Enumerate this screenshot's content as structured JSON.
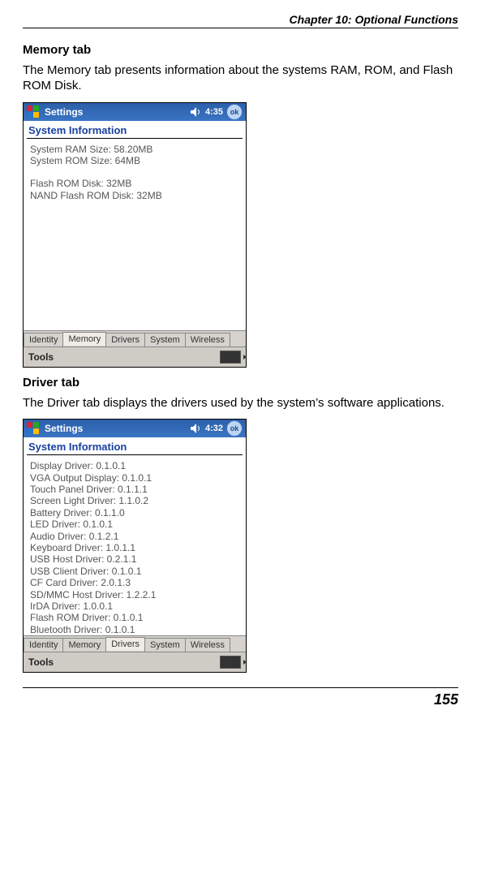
{
  "chapter": "Chapter 10: Optional Functions",
  "page_number": "155",
  "section1": {
    "title": "Memory tab",
    "desc": "The Memory tab presents information about the systems RAM, ROM, and Flash ROM Disk."
  },
  "section2": {
    "title": "Driver tab",
    "desc": "The Driver tab displays the drivers used by the system’s software applications."
  },
  "shot1": {
    "titlebar_title": "Settings",
    "clock": "4:35",
    "ok": "ok",
    "header": "System Information",
    "lines_group1": [
      "System RAM Size: 58.20MB",
      "System ROM Size: 64MB"
    ],
    "lines_group2": [
      "Flash ROM Disk: 32MB",
      "NAND Flash ROM Disk: 32MB"
    ],
    "tabs": [
      "Identity",
      "Memory",
      "Drivers",
      "System",
      "Wireless"
    ],
    "active_tab_index": 1,
    "toolbar": "Tools"
  },
  "shot2": {
    "titlebar_title": "Settings",
    "clock": "4:32",
    "ok": "ok",
    "header": "System Information",
    "lines": [
      "Display Driver: 0.1.0.1",
      "VGA Output Display: 0.1.0.1",
      "Touch Panel Driver: 0.1.1.1",
      "Screen Light Driver: 1.1.0.2",
      "Battery Driver: 0.1.1.0",
      "LED Driver: 0.1.0.1",
      "Audio Driver: 0.1.2.1",
      "Keyboard Driver: 1.0.1.1",
      "USB Host Driver: 0.2.1.1",
      "USB Client Driver: 0.1.0.1",
      "CF Card Driver: 2.0.1.3",
      "SD/MMC Host Driver: 1.2.2.1",
      "IrDA Driver: 1.0.0.1",
      "Flash ROM Driver: 0.1.0.1",
      "Bluetooth Driver: 0.1.0.1"
    ],
    "tabs": [
      "Identity",
      "Memory",
      "Drivers",
      "System",
      "Wireless"
    ],
    "active_tab_index": 2,
    "toolbar": "Tools"
  }
}
